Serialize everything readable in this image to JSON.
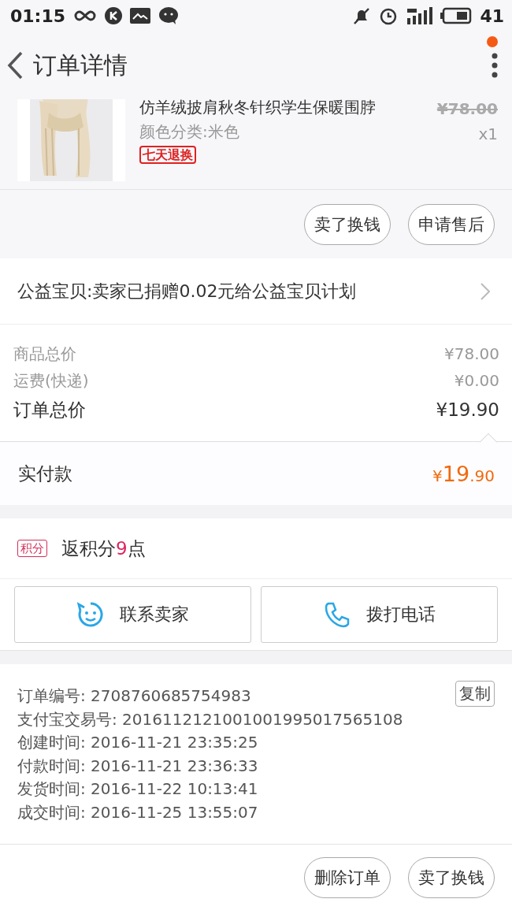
{
  "status_bar": {
    "time": "01:15",
    "battery": "41"
  },
  "header": {
    "title": "订单详情",
    "has_notification": true
  },
  "product": {
    "title": "仿羊绒披肩秋冬针织学生保暖围脖",
    "sku": "颜色分类:米色",
    "tag": "七天退换",
    "price": "¥78.00",
    "quantity": "x1"
  },
  "item_actions": [
    "卖了换钱",
    "申请售后"
  ],
  "charity": {
    "text": "公益宝贝:卖家已捐赠0.02元给公益宝贝计划"
  },
  "price_rows": [
    {
      "label": "商品总价",
      "value": "¥78.00",
      "kind": "minor"
    },
    {
      "label": "运费(快递)",
      "value": "¥0.00",
      "kind": "minor"
    },
    {
      "label": "订单总价",
      "value": "¥19.90",
      "kind": "total"
    }
  ],
  "paid": {
    "label": "实付款",
    "currency": "¥",
    "integer": "19",
    "fraction": ".90"
  },
  "points": {
    "tag": "积分",
    "prefix": "返积分",
    "value": "9",
    "suffix": "点"
  },
  "contact_buttons": [
    {
      "label": "联系卖家",
      "kind": "chat"
    },
    {
      "label": "拨打电话",
      "kind": "phone"
    }
  ],
  "order_info": {
    "copy_button": "复制",
    "rows": [
      {
        "label": "订单编号:",
        "value": "2708760685754983"
      },
      {
        "label": "支付宝交易号:",
        "value": "2016112121001001995017565108"
      },
      {
        "label": "创建时间:",
        "value": "2016-11-21 23:35:25"
      },
      {
        "label": "付款时间:",
        "value": "2016-11-21 23:36:33"
      },
      {
        "label": "发货时间:",
        "value": "2016-11-22 10:13:41"
      },
      {
        "label": "成交时间:",
        "value": "2016-11-25 13:55:07"
      }
    ]
  },
  "bottom_actions": [
    "删除订单",
    "卖了换钱"
  ]
}
